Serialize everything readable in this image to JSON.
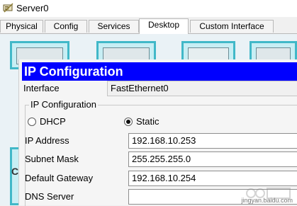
{
  "window": {
    "title": "Server0"
  },
  "tabs": [
    {
      "label": "Physical"
    },
    {
      "label": "Config"
    },
    {
      "label": "Services"
    },
    {
      "label": "Desktop",
      "active": true
    },
    {
      "label": "Custom Interface"
    }
  ],
  "desktop": {
    "partial_label": "C"
  },
  "ip_config": {
    "title": "IP Configuration",
    "interface_label": "Interface",
    "interface_value": "FastEthernet0",
    "group_label": "IP Configuration",
    "dhcp_label": "DHCP",
    "static_label": "Static",
    "selected_mode": "static",
    "fields": [
      {
        "label": "IP Address",
        "value": "192.168.10.253"
      },
      {
        "label": "Subnet Mask",
        "value": "255.255.255.0"
      },
      {
        "label": "Default Gateway",
        "value": "192.168.10.254"
      },
      {
        "label": "DNS Server",
        "value": ""
      }
    ]
  },
  "watermark": {
    "text": "jingyan.baidu.com"
  },
  "colors": {
    "title_bar_blue": "#0000ff",
    "desktop_teal": "#41b8c8"
  },
  "icons": [
    "server-app-icon",
    "ip-configuration-app-icon",
    "terminal-app-icon",
    "command-prompt-app-icon",
    "web-browser-app-icon"
  ]
}
